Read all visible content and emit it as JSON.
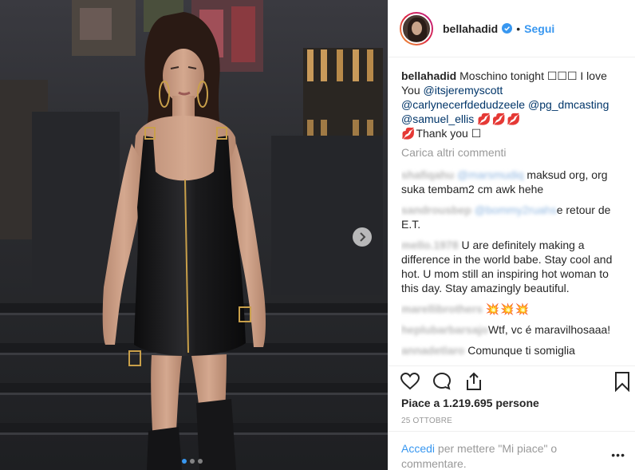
{
  "post": {
    "username": "bellahadid",
    "bullet": "•",
    "follow_label": "Segui",
    "caption": {
      "username": "bellahadid",
      "text": "Moschino tonight ☐☐☐ I love You",
      "mentions": [
        "@itsjeremyscott",
        "@carlynecerfdedudzeele",
        "@pg_dmcasting",
        "@samuel_ellis"
      ],
      "emoji_kiss": "💋💋💋",
      "emoji_kiss_single": "💋",
      "thanks": "Thank you ☐"
    },
    "load_more_label": "Carica altri commenti",
    "comments": [
      {
        "user": "shafiqahu",
        "mention": "@marsmudiq",
        "text": "maksud org, org suka tembam2 cm awk hehe"
      },
      {
        "user": "sandrousbep",
        "mention": "@bommy2ruahs",
        "text": "e retour de E.T."
      },
      {
        "user": "mello.1978",
        "mention": "",
        "text": "U are definitely making a difference in the world babe. Stay cool and hot. U mom still an inspiring hot woman to this day. Stay amazingly beautiful."
      },
      {
        "user": "marellibrothers",
        "mention": "",
        "text": "💥💥💥"
      },
      {
        "user": "heplubarbarsajo",
        "mention": "",
        "text": "Wtf, vc é maravilhosaaa!"
      },
      {
        "user": "annadetlaro",
        "mention": "",
        "text": "Comunque ti somiglia"
      }
    ],
    "likes_text": "Piace a 1.219.695 persone",
    "date": "25 OTTOBRE",
    "footer": {
      "login_label": "Accedi",
      "rest": " per mettere \"Mi piace\" o commentare."
    },
    "more_label": "•••"
  },
  "media": {
    "slides": 3,
    "active_slide": 1,
    "icons": [
      "chevron-right-icon"
    ]
  },
  "colors": {
    "accent": "#3897f0",
    "mention": "#003569",
    "muted": "#999999",
    "text": "#262626"
  }
}
